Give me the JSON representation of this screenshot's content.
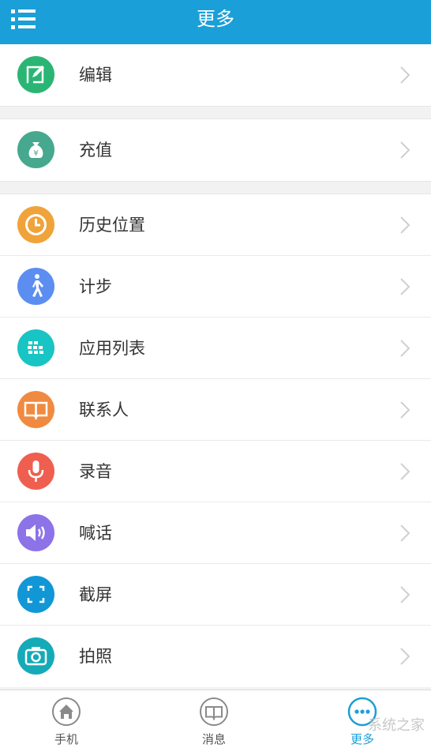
{
  "header": {
    "title": "更多"
  },
  "menu": {
    "group1": [
      {
        "label": "编辑",
        "icon": "edit-icon",
        "color": "#2bb574"
      }
    ],
    "group2": [
      {
        "label": "充值",
        "icon": "money-bag-icon",
        "color": "#46a88e"
      }
    ],
    "group3": [
      {
        "label": "历史位置",
        "icon": "clock-icon",
        "color": "#f0a33a"
      },
      {
        "label": "计步",
        "icon": "walking-icon",
        "color": "#5b8ef0"
      },
      {
        "label": "应用列表",
        "icon": "apps-grid-icon",
        "color": "#19c4c4"
      },
      {
        "label": "联系人",
        "icon": "book-icon",
        "color": "#f08a40"
      },
      {
        "label": "录音",
        "icon": "microphone-icon",
        "color": "#ef5f4f"
      },
      {
        "label": "喊话",
        "icon": "speaker-icon",
        "color": "#8c73e8"
      },
      {
        "label": "截屏",
        "icon": "screenshot-icon",
        "color": "#1197d6"
      },
      {
        "label": "拍照",
        "icon": "camera-icon",
        "color": "#15aab8"
      }
    ]
  },
  "tabbar": {
    "items": [
      {
        "label": "手机",
        "icon": "home-icon",
        "active": false
      },
      {
        "label": "消息",
        "icon": "book-icon",
        "active": false
      },
      {
        "label": "更多",
        "icon": "more-dots-icon",
        "active": true
      }
    ],
    "active_color": "#1b9fd8"
  },
  "watermark": {
    "text": "系统之家"
  }
}
